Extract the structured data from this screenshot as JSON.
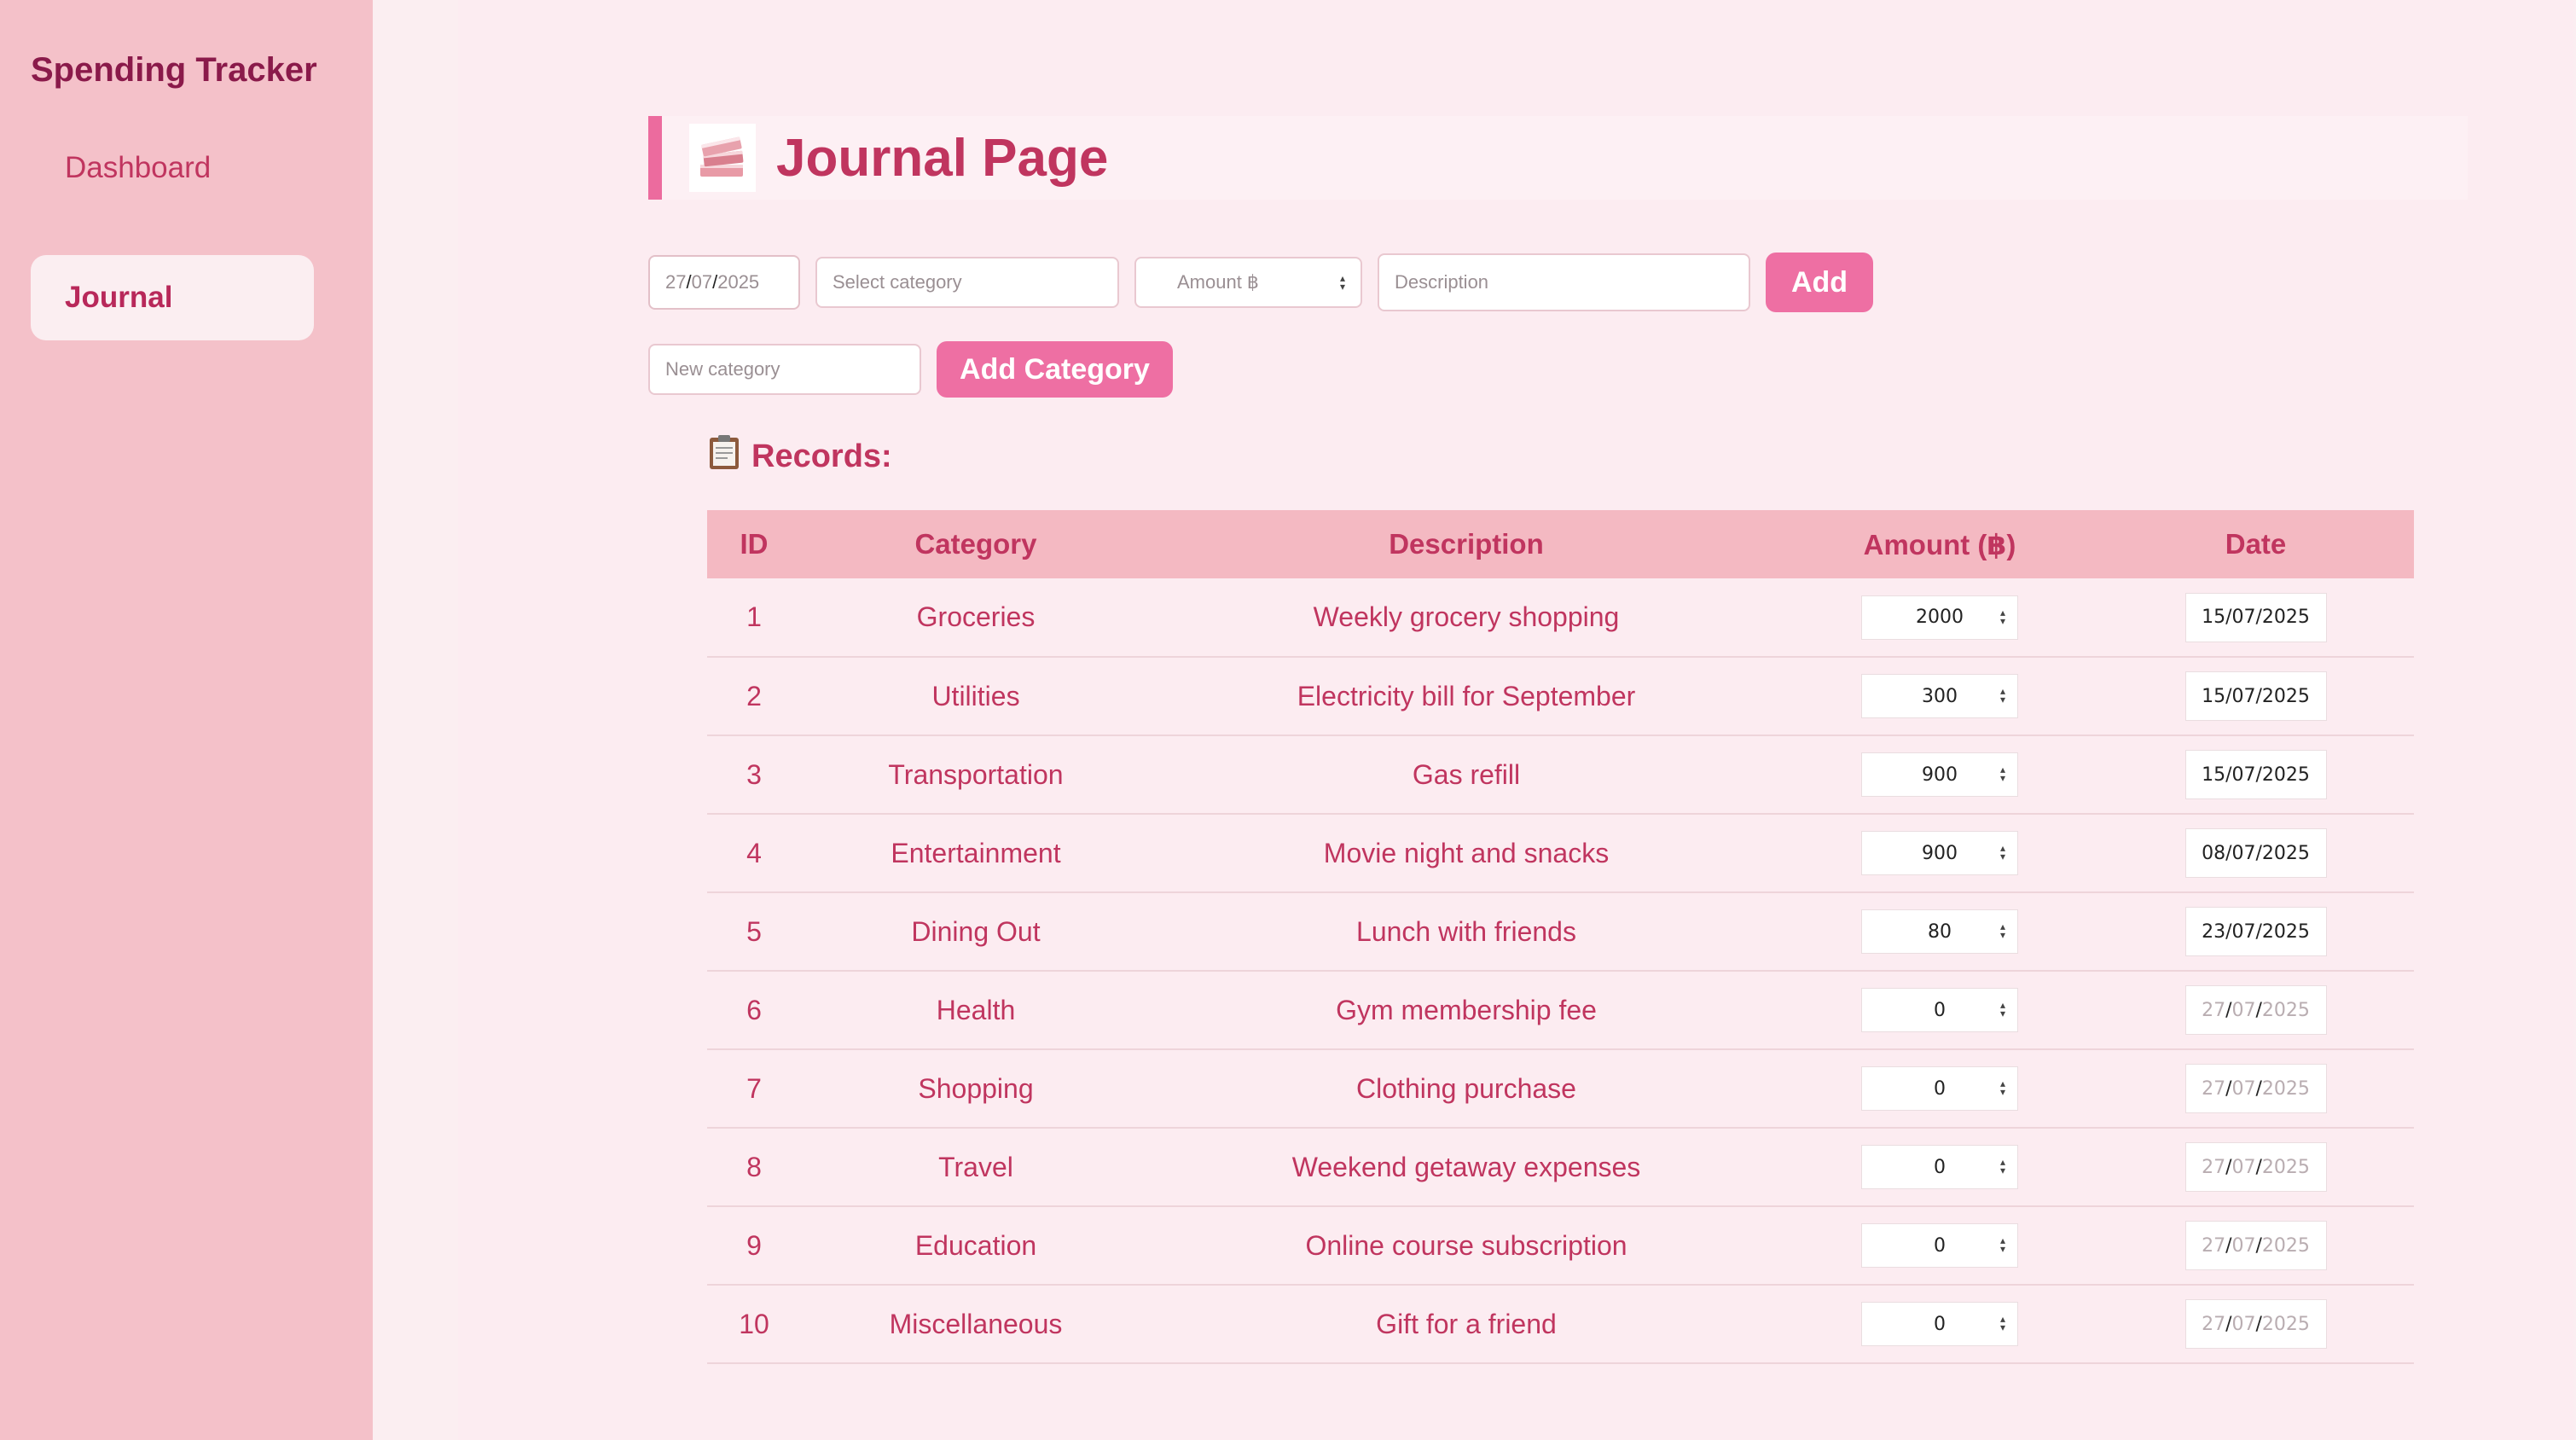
{
  "sidebar": {
    "brand": "Spending Tracker",
    "items": [
      {
        "label": "Dashboard",
        "active": false
      },
      {
        "label": "Journal",
        "active": true
      }
    ]
  },
  "header": {
    "icon": "books-icon",
    "title": "Journal Page"
  },
  "form": {
    "date_day": "27",
    "date_month": "07",
    "date_year": "2025",
    "category_placeholder": "Select category",
    "amount_placeholder": "Amount ฿",
    "description_placeholder": "Description",
    "add_label": "Add",
    "new_category_placeholder": "New category",
    "add_category_label": "Add Category"
  },
  "records": {
    "title": "Records:",
    "icon": "clipboard-icon",
    "columns": [
      "ID",
      "Category",
      "Description",
      "Amount (฿)",
      "Date"
    ],
    "rows": [
      {
        "id": "1",
        "category": "Groceries",
        "description": "Weekly grocery shopping",
        "amount": "2000",
        "date": "15/07/2025",
        "date_set": true
      },
      {
        "id": "2",
        "category": "Utilities",
        "description": "Electricity bill for September",
        "amount": "300",
        "date": "15/07/2025",
        "date_set": true
      },
      {
        "id": "3",
        "category": "Transportation",
        "description": "Gas refill",
        "amount": "900",
        "date": "15/07/2025",
        "date_set": true
      },
      {
        "id": "4",
        "category": "Entertainment",
        "description": "Movie night and snacks",
        "amount": "900",
        "date": "08/07/2025",
        "date_set": true
      },
      {
        "id": "5",
        "category": "Dining Out",
        "description": "Lunch with friends",
        "amount": "80",
        "date": "23/07/2025",
        "date_set": true
      },
      {
        "id": "6",
        "category": "Health",
        "description": "Gym membership fee",
        "amount": "0",
        "date": "27/07/2025",
        "date_set": false
      },
      {
        "id": "7",
        "category": "Shopping",
        "description": "Clothing purchase",
        "amount": "0",
        "date": "27/07/2025",
        "date_set": false
      },
      {
        "id": "8",
        "category": "Travel",
        "description": "Weekend getaway expenses",
        "amount": "0",
        "date": "27/07/2025",
        "date_set": false
      },
      {
        "id": "9",
        "category": "Education",
        "description": "Online course subscription",
        "amount": "0",
        "date": "27/07/2025",
        "date_set": false
      },
      {
        "id": "10",
        "category": "Miscellaneous",
        "description": "Gift for a friend",
        "amount": "0",
        "date": "27/07/2025",
        "date_set": false
      }
    ]
  },
  "colors": {
    "sidebar_bg": "#f4c1c9",
    "accent": "#ee6fa3",
    "text_primary": "#c0355f",
    "brand_text": "#8a1a4a",
    "table_header_bg": "#f4b9c2"
  }
}
